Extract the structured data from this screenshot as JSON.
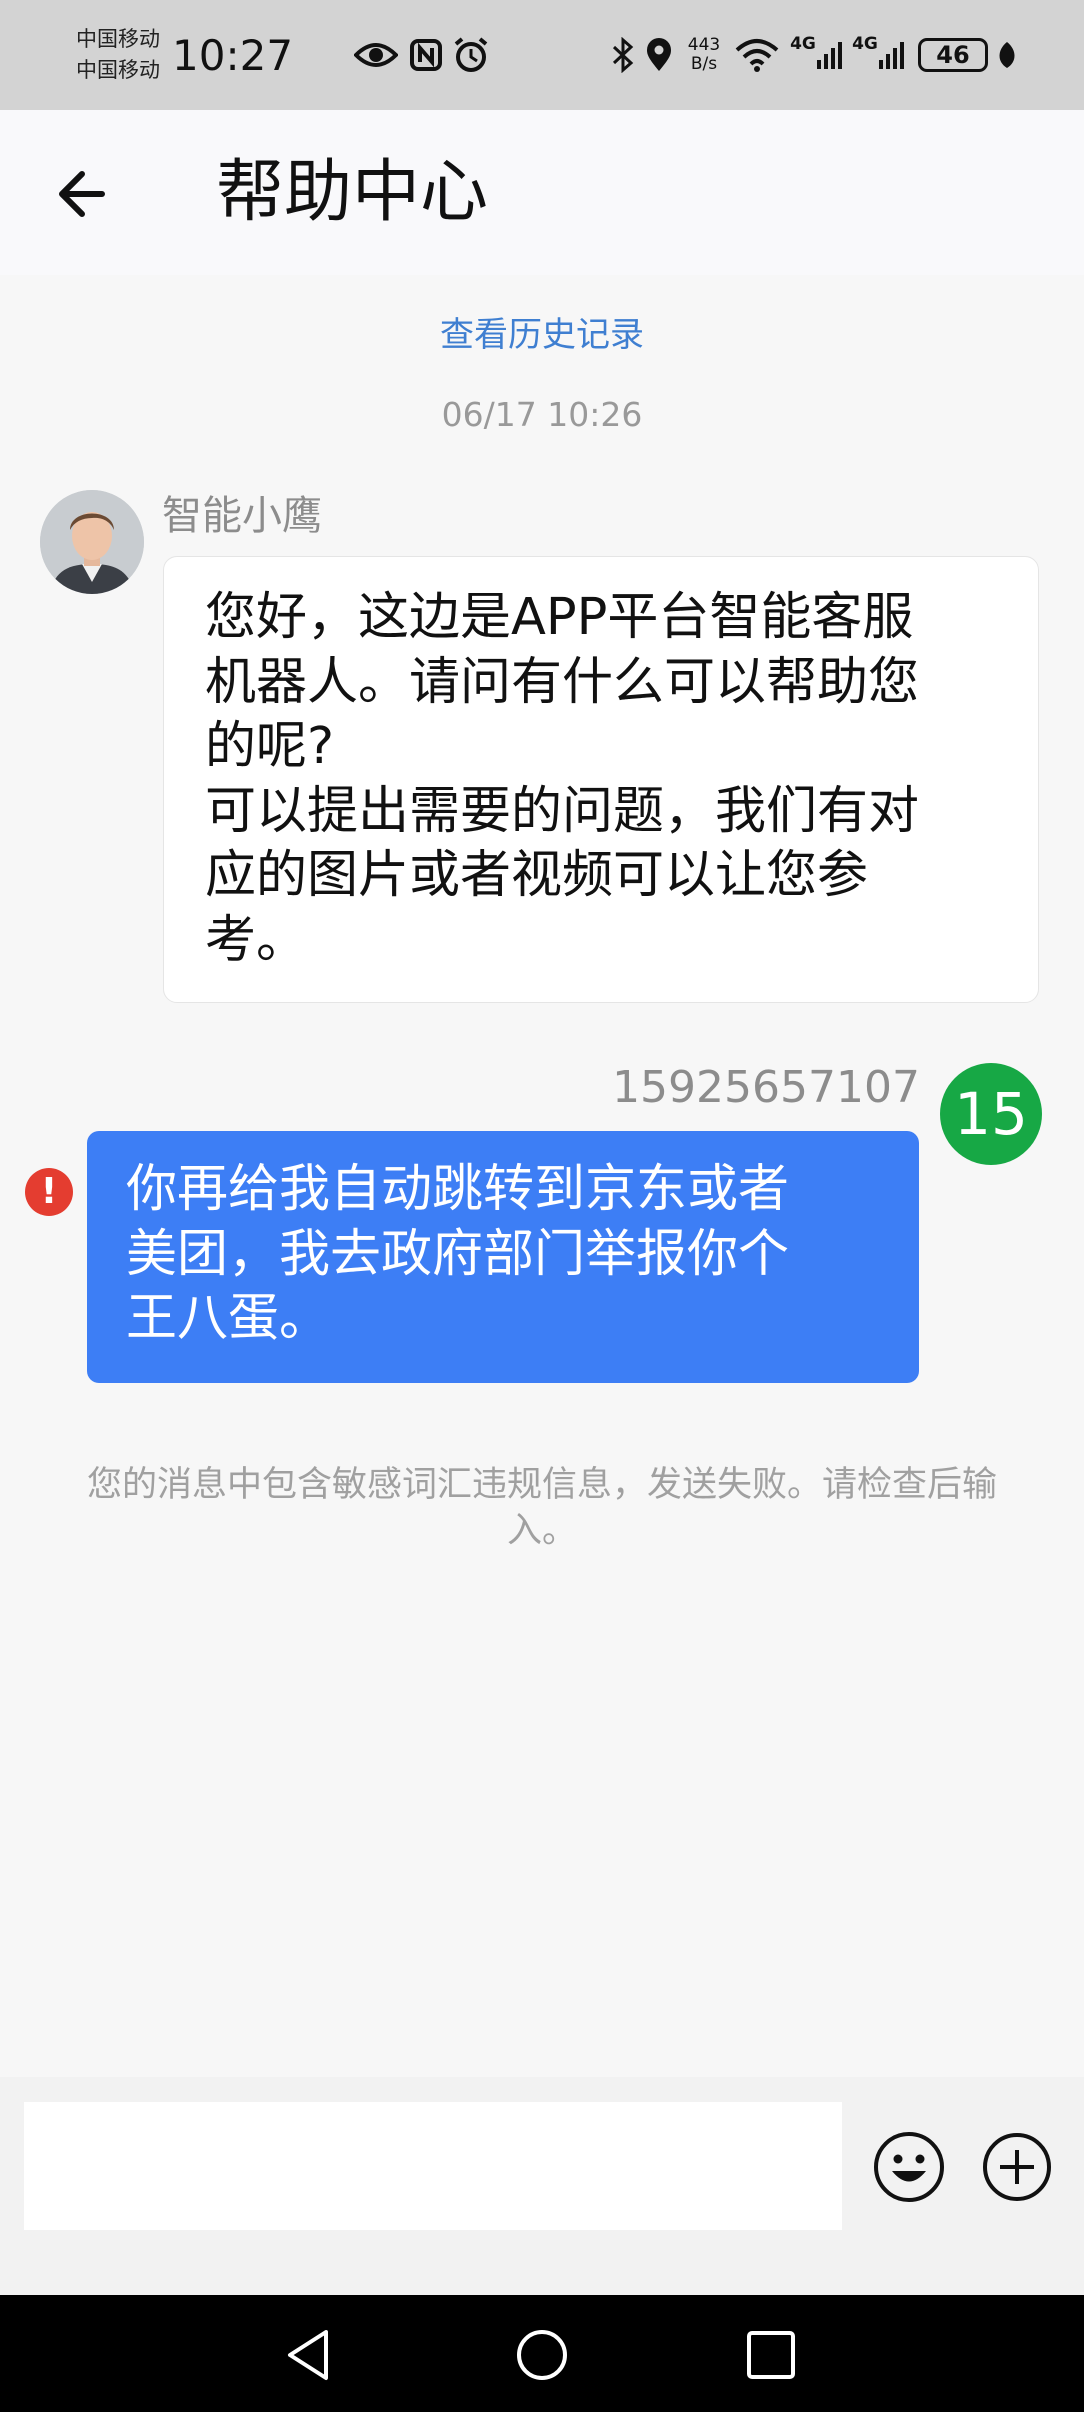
{
  "status_bar": {
    "carrier_1": "中国移动",
    "carrier_2": "中国移动",
    "time": "10:27",
    "net_speed_value": "443",
    "net_speed_unit": "B/s",
    "network_1": "4G",
    "network_2": "4G",
    "battery": "46",
    "icons": [
      "eye-icon",
      "nfc-icon",
      "alarm-icon",
      "bluetooth-icon",
      "location-icon",
      "wifi-icon",
      "signal-icon",
      "leaf-icon"
    ]
  },
  "header": {
    "title": "帮助中心",
    "back_icon": "arrow-left-icon"
  },
  "chat": {
    "history_link": "查看历史记录",
    "timestamp": "06/17 10:26",
    "bot": {
      "name": "智能小鹰",
      "message": "您好，这边是APP平台智能客服\n机器人。请问有什么可以帮助您\n的呢?\n可以提出需要的问题，我们有对\n应的图片或者视频可以让您参\n考。"
    },
    "user": {
      "phone": "15925657107",
      "avatar_text": "15",
      "message": "你再给我自动跳转到京东或者\n美团，我去政府部门举报你个\n王八蛋。",
      "status_icon": "error-icon"
    },
    "warning": "您的消息中包含敏感词汇违规信息，发送失败。请检查后输\n入。"
  },
  "input_bar": {
    "placeholder": "",
    "value": "",
    "emoji_icon": "smiley-icon",
    "add_icon": "plus-circle-icon"
  },
  "nav_bar": {
    "icons": [
      "back-triangle-icon",
      "home-circle-icon",
      "recents-square-icon"
    ]
  },
  "colors": {
    "accent_blue": "#3d7ef5",
    "link_blue": "#3f7fd1",
    "user_avatar_green": "#17a845",
    "error_red": "#e43d30"
  }
}
